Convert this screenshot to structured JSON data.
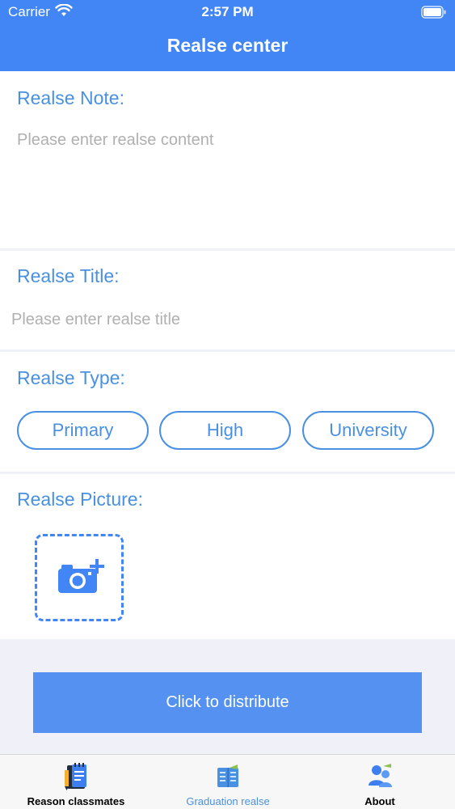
{
  "status_bar": {
    "carrier": "Carrier",
    "time": "2:57 PM"
  },
  "nav": {
    "title": "Realse center"
  },
  "note": {
    "label": "Realse Note:",
    "placeholder": "Please enter realse content"
  },
  "title_field": {
    "label": "Realse Title:",
    "placeholder": "Please enter realse title"
  },
  "type": {
    "label": "Realse Type:",
    "options": [
      "Primary",
      "High",
      "University"
    ]
  },
  "picture": {
    "label": "Realse Picture:",
    "upload_icon": "camera-add-icon"
  },
  "distribute": {
    "label": "Click to distribute"
  },
  "tabbar": {
    "tabs": [
      {
        "label": "Reason classmates",
        "icon": "notebook-icon",
        "active": false
      },
      {
        "label": "Graduation realse",
        "icon": "book-icon",
        "active": true
      },
      {
        "label": "About",
        "icon": "users-icon",
        "active": false
      }
    ]
  },
  "colors": {
    "primary": "#4285f4",
    "label_blue": "#4a90e2",
    "button": "#5491f0",
    "background": "#f0f0f8"
  }
}
